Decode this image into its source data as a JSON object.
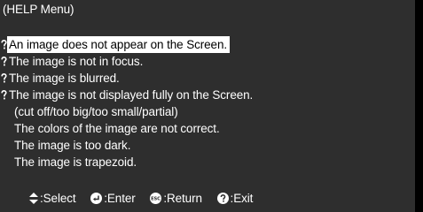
{
  "title": "(HELP Menu)",
  "items": [
    {
      "label": "An image does not appear on the Screen.",
      "icon": "question-icon",
      "selected": true
    },
    {
      "label": "The image is not in focus.",
      "icon": "question-icon",
      "selected": false
    },
    {
      "label": "The image is blurred.",
      "icon": "question-icon",
      "selected": false
    },
    {
      "label": "The image is not displayed fully on the Screen.",
      "icon": "question-icon",
      "selected": false
    },
    {
      "label": "(cut off/too big/too small/partial)",
      "icon": "",
      "selected": false
    },
    {
      "label": "The colors of the image are not correct.",
      "icon": "",
      "selected": false
    },
    {
      "label": "The image is too dark.",
      "icon": "",
      "selected": false
    },
    {
      "label": "The image is trapezoid.",
      "icon": "",
      "selected": false
    }
  ],
  "footer": {
    "select": {
      "icon": "up-down-arrows-icon",
      "label": ":Select"
    },
    "enter": {
      "icon": "enter-icon",
      "label": ":Enter"
    },
    "return": {
      "icon": "esc-icon",
      "icon_text": "ESC",
      "label": ":Return"
    },
    "exit": {
      "icon": "help-icon",
      "label": ":Exit"
    }
  },
  "colors": {
    "panel_background": "#2e2e2e",
    "outer_background": "#000000",
    "text": "#ffffff",
    "highlight_background": "#ffffff",
    "highlight_text": "#000000"
  }
}
